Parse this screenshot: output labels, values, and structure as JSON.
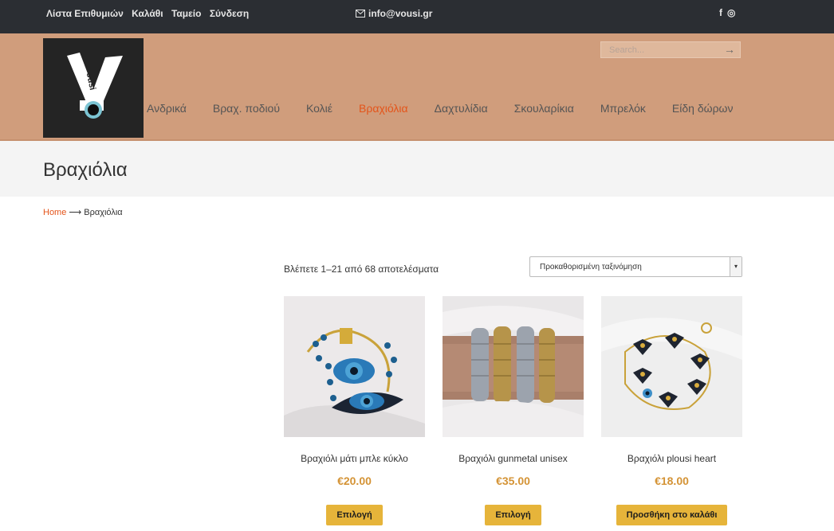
{
  "topbar": {
    "links": [
      "Λίστα Επιθυμιών",
      "Καλάθι",
      "Ταμείο",
      "Σύνδεση"
    ],
    "email": "info@vousi.gr",
    "social": [
      "f",
      "◎"
    ]
  },
  "header": {
    "logo_text": "ousi",
    "search_placeholder": "Search...",
    "nav": [
      "Ανδρικά",
      "Βραχ. ποδιού",
      "Κολιέ",
      "Βραχιόλια",
      "Δαχτυλίδια",
      "Σκουλαρίκια",
      "Μπρελόκ",
      "Είδη δώρων"
    ]
  },
  "page": {
    "title": "Βραχιόλια"
  },
  "breadcrumb": {
    "home": "Home",
    "separator": "⟶",
    "current": "Βραχιόλια"
  },
  "shop": {
    "results_text": "Βλέπετε 1–21 από 68 αποτελέσματα",
    "sort_value": "Προκαθορισμένη ταξινόμηση",
    "products": [
      {
        "name": "Βραχιόλι μάτι μπλε κύκλο",
        "price": "€20.00",
        "button": "Επιλογή"
      },
      {
        "name": "Βραχιόλι gunmetal unisex",
        "price": "€35.00",
        "button": "Επιλογή"
      },
      {
        "name": "Βραχιόλι plousi heart",
        "price": "€18.00",
        "button": "Προσθήκη στο καλάθι"
      }
    ]
  },
  "colors": {
    "topbar": "#2b2e33",
    "header": "#d09d7c",
    "accent": "#e4541a",
    "price": "#d49335",
    "button": "#e6b43a"
  }
}
